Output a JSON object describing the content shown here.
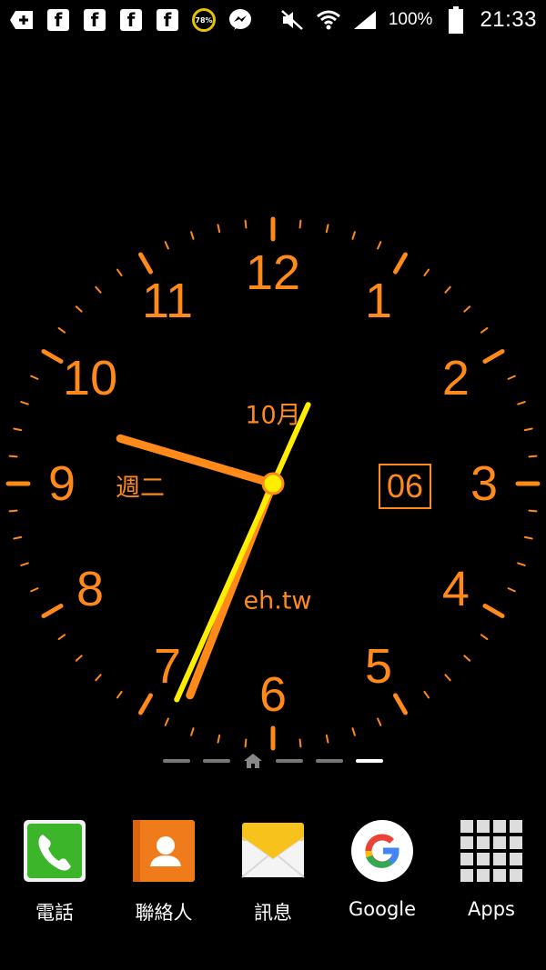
{
  "status_bar": {
    "left_icons": [
      "plus-notification-icon",
      "facebook-icon",
      "facebook-icon",
      "facebook-icon",
      "facebook-icon",
      "battery-saver-icon",
      "messenger-icon"
    ],
    "battery_saver_text": "78%",
    "right_icons": [
      "mute-icon",
      "wifi-icon",
      "signal-icon",
      "battery-icon"
    ],
    "battery_percent": "100%",
    "time": "21:33"
  },
  "clock": {
    "numbers": [
      "12",
      "1",
      "2",
      "3",
      "4",
      "5",
      "6",
      "7",
      "8",
      "9",
      "10",
      "11"
    ],
    "month_label": "10月",
    "weekday_label": "週二",
    "date_day": "06",
    "brand_text": "eh.tw",
    "time_shown": {
      "hour": 9,
      "minute": 33,
      "second": 34
    },
    "colors": {
      "accent": "#ff8a1a",
      "second_hand": "#ffee00"
    }
  },
  "page_indicator": {
    "pages": [
      "page",
      "page",
      "home",
      "page",
      "page",
      "page"
    ],
    "active_index": 5
  },
  "dock": {
    "items": [
      {
        "label": "電話",
        "icon": "phone-icon"
      },
      {
        "label": "聯絡人",
        "icon": "contacts-icon"
      },
      {
        "label": "訊息",
        "icon": "messages-icon"
      },
      {
        "label": "Google",
        "icon": "google-icon"
      },
      {
        "label": "Apps",
        "icon": "apps-grid-icon"
      }
    ]
  }
}
